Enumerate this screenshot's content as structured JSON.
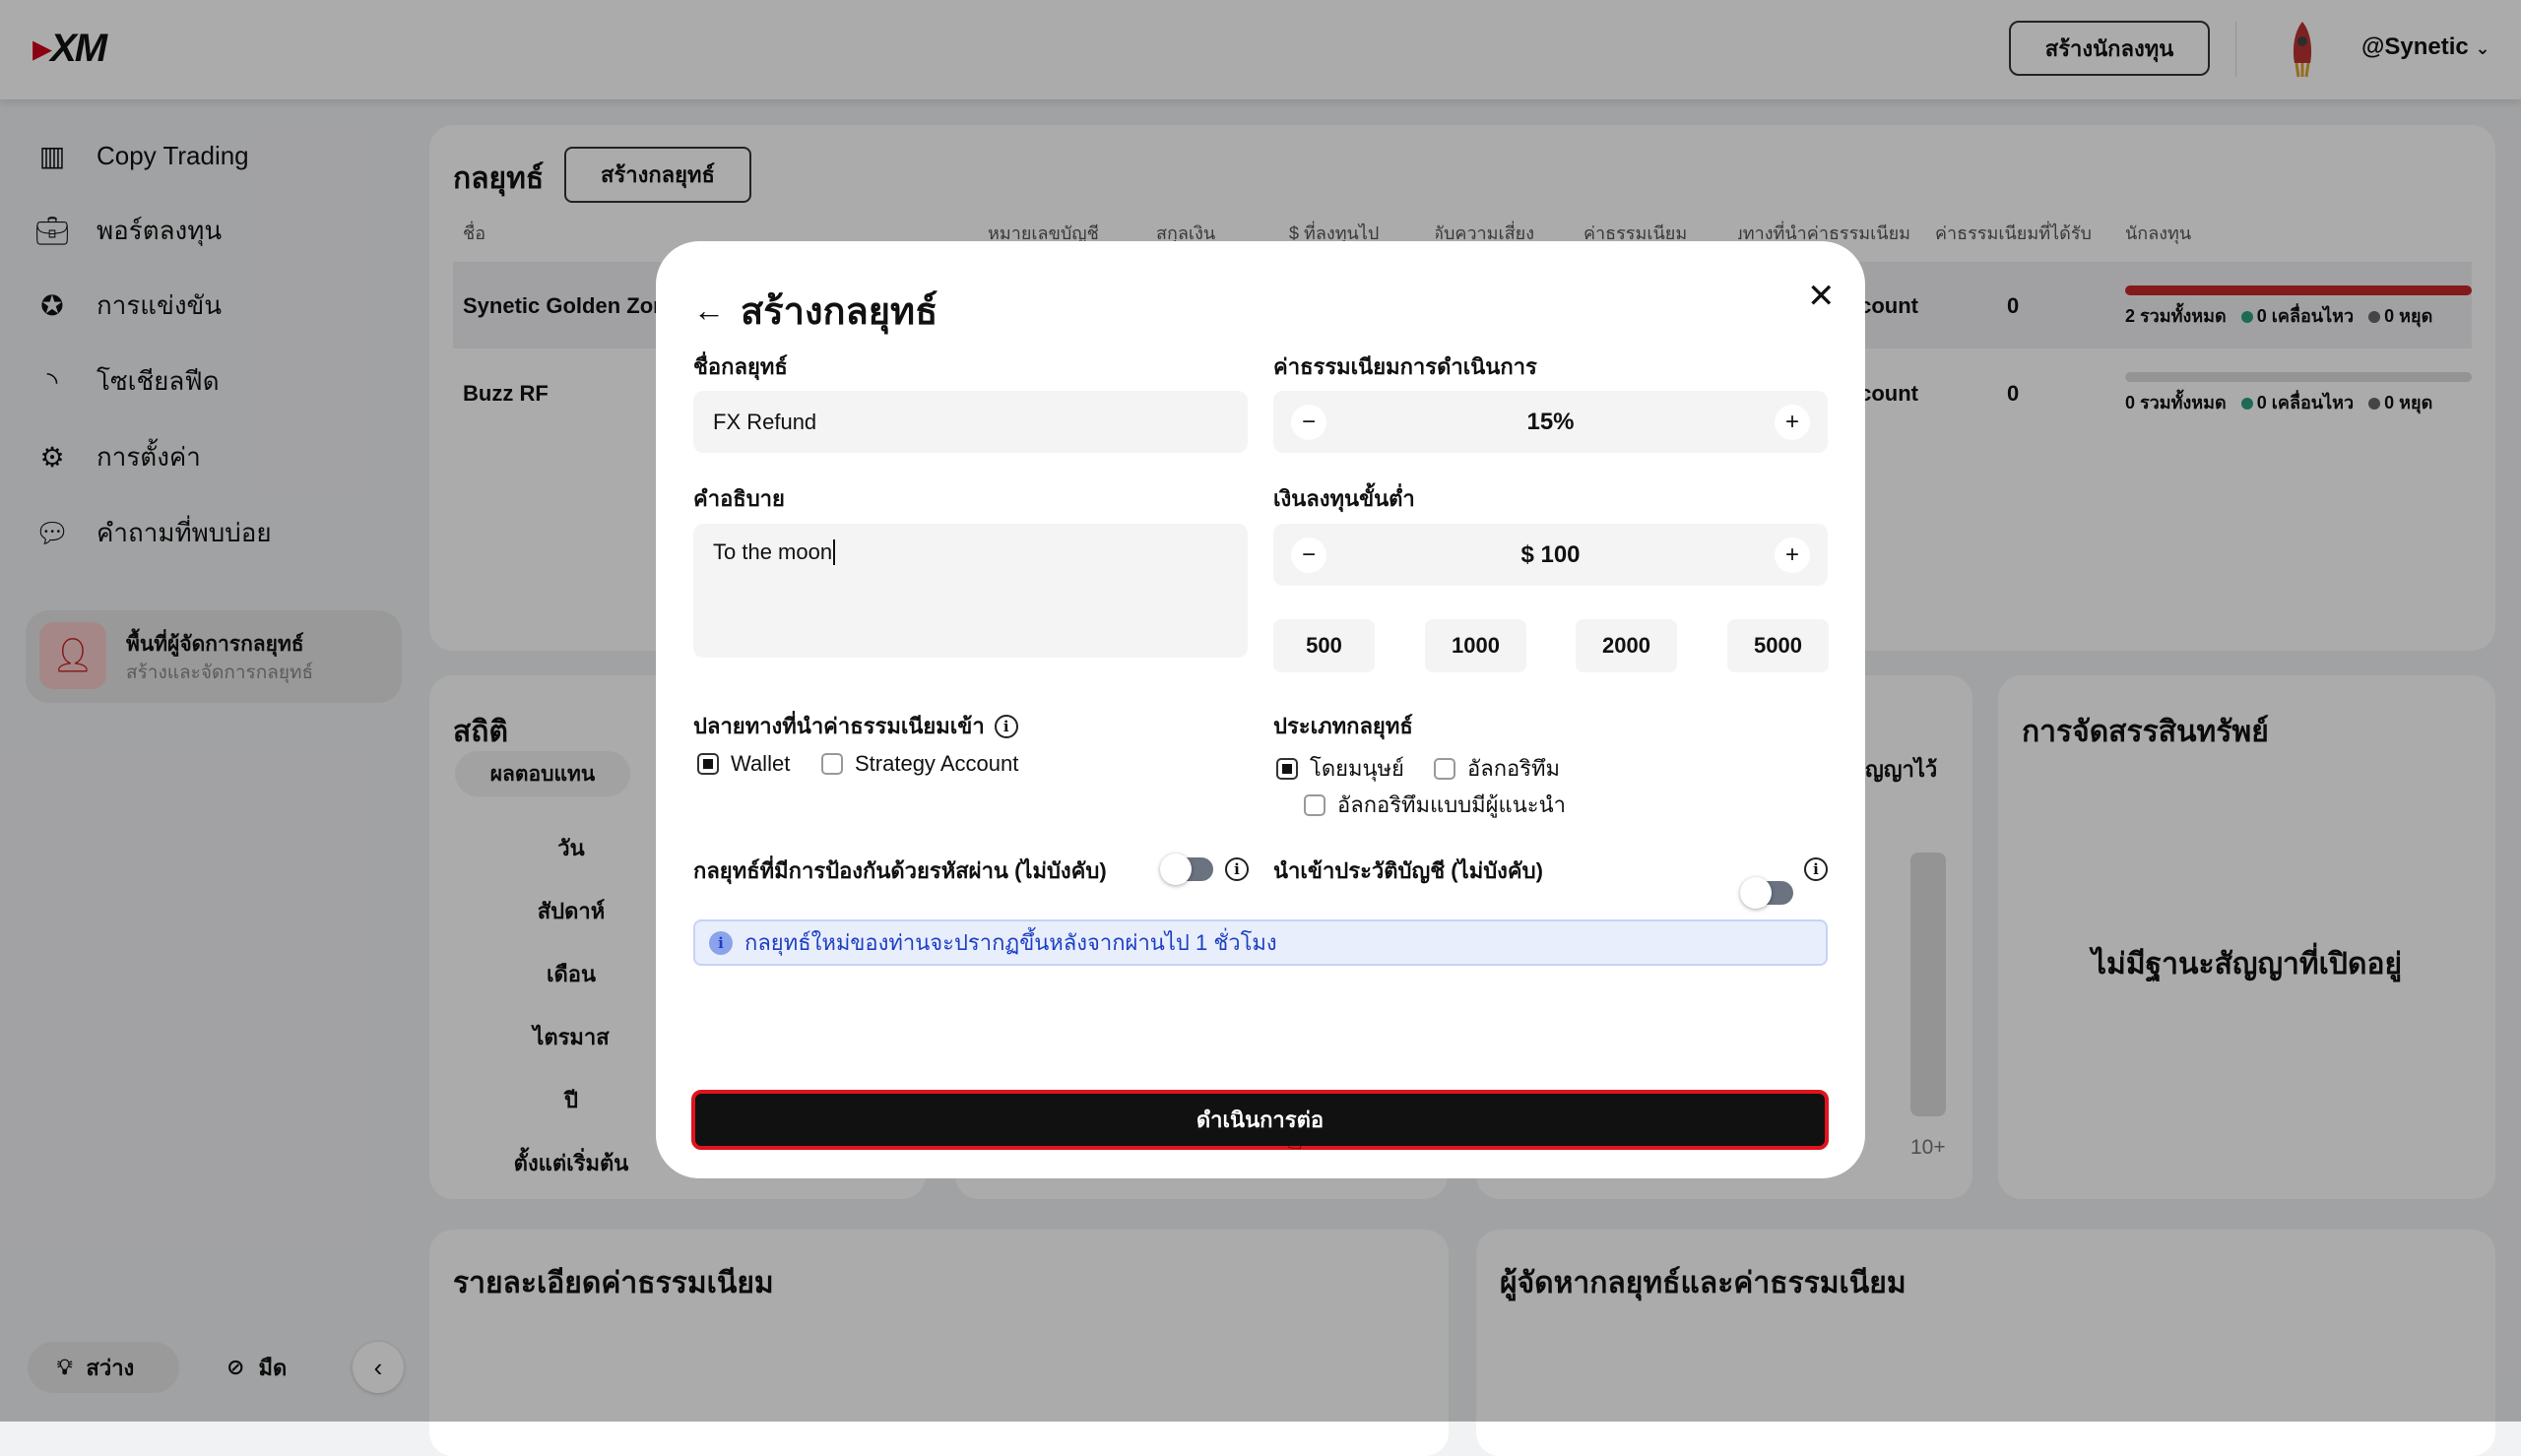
{
  "header": {
    "logo": "XM",
    "create_investor": "สร้างนักลงทุน",
    "username": "@Synetic"
  },
  "sidebar": {
    "items": [
      {
        "label": "Copy Trading",
        "icon": "bar-chart-icon"
      },
      {
        "label": "พอร์ตลงทุน",
        "icon": "briefcase-icon"
      },
      {
        "label": "การแข่งขัน",
        "icon": "medal-icon"
      },
      {
        "label": "โซเชียลฟีด",
        "icon": "rss-icon"
      },
      {
        "label": "การตั้งค่า",
        "icon": "gear-icon"
      },
      {
        "label": "คำถามที่พบบ่อย",
        "icon": "chat-icon"
      }
    ],
    "manager_card": {
      "title": "พื้นที่ผู้จัดการกลยุทธ์",
      "subtitle": "สร้างและจัดการกลยุทธ์"
    },
    "theme": {
      "light": "สว่าง",
      "dark": "มืด"
    }
  },
  "strategies": {
    "title": "กลยุทธ์",
    "create_button": "สร้างกลยุทธ์",
    "columns": [
      "ชื่อ",
      "หมายเลขบัญชี",
      "สกุลเงิน",
      "$ ที่ลงทุนไป",
      "ระดับความเสี่ยง",
      "ค่าธรรมเนียม",
      "ปลายทางที่นำค่าธรรมเนียม",
      "ค่าธรรมเนียมที่ได้รับ",
      "นักลงทุน"
    ],
    "rows": [
      {
        "name": "Synetic Golden Zone",
        "dest": "Account",
        "received": "0",
        "total": "2 รวมทั้งหมด",
        "moving": "0 เคลื่อนไหว",
        "stopped": "0 หยุด"
      },
      {
        "name": "Buzz RF",
        "dest": "Account",
        "received": "0",
        "total": "0 รวมทั้งหมด",
        "moving": "0 เคลื่อนไหว",
        "stopped": "0 หยุด"
      }
    ]
  },
  "stats": {
    "title": "สถิติ",
    "tab": "ผลตอบแทน",
    "periods": [
      "วัน",
      "สัปดาห์",
      "เดือน",
      "ไตรมาส",
      "ปี",
      "ตั้งแต่เริ่มต้น"
    ],
    "partial_label": "ญญาไว้",
    "axis_label": "10+"
  },
  "assets": {
    "title": "การจัดสรรสินทรัพย์",
    "empty": "ไม่มีฐานะสัญญาที่เปิดอยู่"
  },
  "fee_details": {
    "title": "รายละเอียดค่าธรรมเนียม"
  },
  "managers_fees": {
    "title": "ผู้จัดหากลยุทธ์และค่าธรรมเนียม"
  },
  "modal": {
    "title": "สร้างกลยุทธ์",
    "name_label": "ชื่อกลยุทธ์",
    "name_value": "FX Refund",
    "fee_label": "ค่าธรรมเนียมการดำเนินการ",
    "fee_value": "15%",
    "desc_label": "คำอธิบาย",
    "desc_value": "To the moon",
    "min_label": "เงินลงทุนขั้นต่ำ",
    "min_value": "$ 100",
    "presets": [
      "500",
      "1000",
      "2000",
      "5000"
    ],
    "fee_dest_label": "ปลายทางที่นำค่าธรรมเนียมเข้า",
    "fee_dest_options": [
      {
        "label": "Wallet",
        "checked": true
      },
      {
        "label": "Strategy Account",
        "checked": false
      }
    ],
    "type_label": "ประเภทกลยุทธ์",
    "type_options": [
      {
        "label": "โดยมนุษย์",
        "checked": true
      },
      {
        "label": "อัลกอริทึม",
        "checked": false
      },
      {
        "label": "อัลกอริทึมแบบมีผู้แนะนำ",
        "checked": false
      }
    ],
    "password_label": "กลยุทธ์ที่มีการป้องกันด้วยรหัสผ่าน (ไม่บังคับ)",
    "password_on": false,
    "import_label": "นำเข้าประวัติบัญชี (ไม่บังคับ)",
    "import_on": false,
    "notice": "กลยุทธ์ใหม่ของท่านจะปรากฏขึ้นหลังจากผ่านไป 1 ชั่วโมง",
    "continue": "ดำเนินการต่อ"
  },
  "colors": {
    "accent": "#d0021b",
    "progress_red": "#c62828",
    "dot_green": "#2e9e7e",
    "notice_bg": "#e8eefc",
    "notice_text": "#1d3fc4"
  }
}
